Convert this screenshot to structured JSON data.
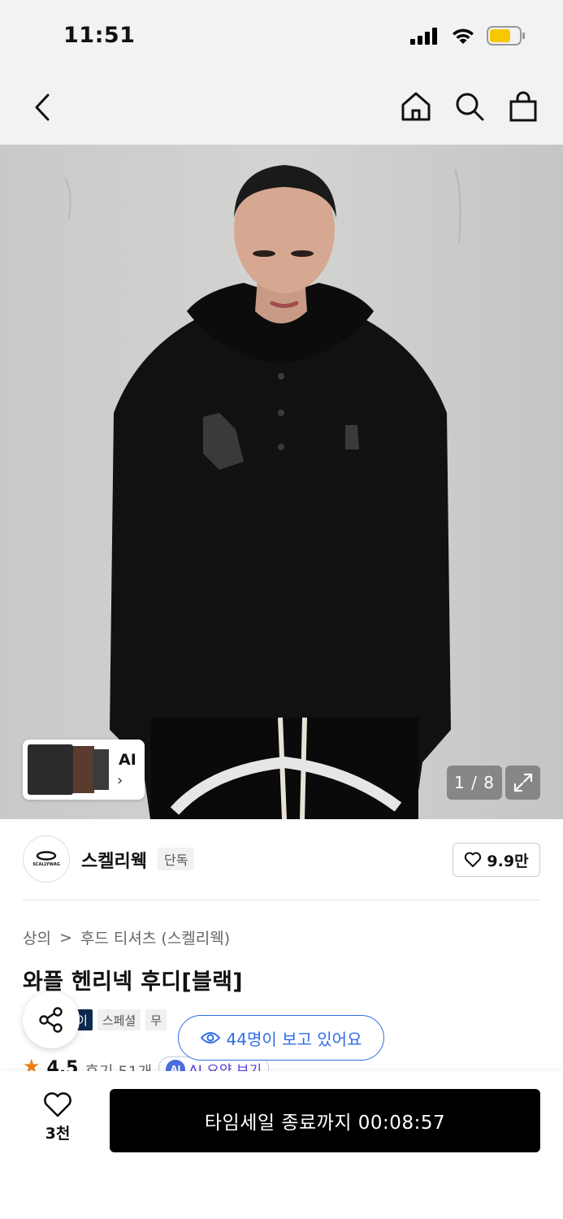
{
  "status_bar": {
    "time": "11:51"
  },
  "gallery": {
    "counter": "1 / 8",
    "ai_label": "AI",
    "ai_arrow": "›"
  },
  "brand": {
    "name": "스켈리웩",
    "badge": "단독",
    "logo_text": "SCALLYWAG",
    "likes": "9.9만"
  },
  "breadcrumb": {
    "category": "상의",
    "separator": ">",
    "subcategory": "후드 티셔츠 (스켈리웩)"
  },
  "product": {
    "title": "와플 헨리넥 후디[블랙]"
  },
  "tags": [
    {
      "label": "이"
    },
    {
      "label": "스페셜"
    },
    {
      "label": "무"
    }
  ],
  "rating": {
    "star": "★",
    "score": "4.5",
    "reviews": "후기 51개",
    "ai_badge": "AI",
    "ai_summary": "AI 요약 보기"
  },
  "viewers": {
    "text": "44명이 보고 있어요"
  },
  "bottom": {
    "wish_count": "3천",
    "buy_label": "타임세일 종료까지 00:08:57"
  },
  "colors": {
    "accent_blue": "#2f6de5",
    "tag_navy": "#0b2a4e",
    "star_orange": "#f07e1b",
    "battery_yellow": "#f5c800"
  }
}
